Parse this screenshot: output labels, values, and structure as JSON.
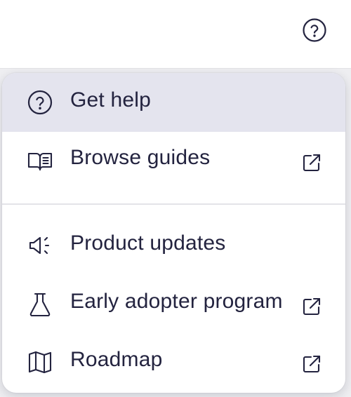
{
  "colors": {
    "text": "#23233f",
    "active_bg": "#e4e4ee",
    "divider": "#e3e3e8"
  },
  "header": {
    "help_icon": "question-circle-icon"
  },
  "menu": {
    "items": [
      {
        "label": "Get help",
        "icon": "question-circle-icon",
        "external": false,
        "active": true
      },
      {
        "label": "Browse guides",
        "icon": "book-icon",
        "external": true,
        "active": false
      },
      {
        "label": "Product updates",
        "icon": "megaphone-icon",
        "external": false,
        "active": false
      },
      {
        "label": "Early adopter program",
        "icon": "flask-icon",
        "external": true,
        "active": false
      },
      {
        "label": "Roadmap",
        "icon": "map-icon",
        "external": true,
        "active": false
      }
    ]
  }
}
